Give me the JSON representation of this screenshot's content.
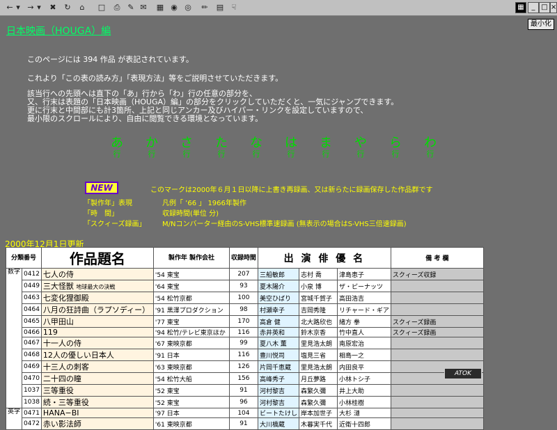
{
  "toolbar": {
    "icons": [
      "back-icon",
      "forward-icon",
      "stop-icon",
      "refresh-icon",
      "home-icon",
      "folder-icon",
      "print-icon",
      "edit-icon",
      "mail-icon",
      "globe-icon",
      "earth-icon",
      "pen-icon",
      "page-icon",
      "hand-icon"
    ],
    "minimize_label": "最小化"
  },
  "page": {
    "title": "日本映画（HOUGA）編",
    "count_line": "このページには 394 作品 が表記されています。",
    "intro_line": "これより「この表の読み方」「表現方法」等をご説明させていただきます。",
    "desc_lines": [
      "該当行への先頭へは直下の「あ」行から「わ」行の任意の部分を、",
      "又、行末は表題の「日本映画（HOUGA）編」の部分をクリックしていただくと、一気にジャンプできます。",
      "更に行末と中間部にも計3箇所、上記と同じアンカー及びハイパー・リンクを設定していますので、",
      "最小限のスクロールにより、自由に閲覧できる環境となっています。"
    ],
    "kana_index": [
      {
        "char": "あ",
        "gyo": "行"
      },
      {
        "char": "か",
        "gyo": "行"
      },
      {
        "char": "さ",
        "gyo": "行"
      },
      {
        "char": "た",
        "gyo": "行"
      },
      {
        "char": "な",
        "gyo": "行"
      },
      {
        "char": "は",
        "gyo": "行"
      },
      {
        "char": "ま",
        "gyo": "行"
      },
      {
        "char": "や",
        "gyo": "行"
      },
      {
        "char": "ら",
        "gyo": "行"
      },
      {
        "char": "わ",
        "gyo": "行"
      }
    ],
    "new_badge": "NEW",
    "new_desc": "このマークは2000年６月１日以降に上書き再録画、又は新らたに録画保存した作品群です",
    "legend": [
      {
        "term": "「製作年」表現",
        "desc": "凡例「 ’66 」 1966年製作"
      },
      {
        "term": "「時　間」",
        "desc": "収録時間(単位 分)"
      },
      {
        "term": "「スクィーズ録画」",
        "desc": "M/Nコンバーター経由のS-VHS標準速録画 (無表示の場合はS-VHS三倍速録画)"
      }
    ],
    "update_date": "2000年12月1日更新"
  },
  "table": {
    "headers": {
      "num": "分類番号",
      "title": "作品題名",
      "year": "製作年 製作会社",
      "minutes": "収録時間",
      "actors": "出 演 俳 優 名",
      "notes": "備 考 欄"
    },
    "categories": [
      {
        "label": "数字",
        "rows": 11
      },
      {
        "label": "英字",
        "rows": 2
      }
    ],
    "rows": [
      {
        "num": "0412",
        "title": "七人の侍",
        "sub": "",
        "year": "'54 東宝",
        "min": "207",
        "a1": "三船敏郎",
        "a2": "志村 喬",
        "a3": "津島恵子",
        "note": "スクィーズ収録"
      },
      {
        "num": "0449",
        "title": "三大怪獣",
        "sub": "地球最大の決戦",
        "year": "'64 東宝",
        "min": "93",
        "a1": "夏木陽介",
        "a2": "小泉 博",
        "a3": "ザ・ピーナッツ",
        "note": ""
      },
      {
        "num": "0463",
        "title": "七変化狸御殿",
        "sub": "",
        "year": "'54 松竹京都",
        "min": "100",
        "a1": "美空ひばり",
        "a2": "宮城千賀子",
        "a3": "高田浩吉",
        "note": ""
      },
      {
        "num": "0464",
        "title": "八月の狂詩曲（ラプソディー）",
        "sub": "",
        "year": "'91 黒澤プロダクション",
        "min": "98",
        "a1": "村瀬幸子",
        "a2": "吉岡秀隆",
        "a3": "リチャード・ギア",
        "note": ""
      },
      {
        "num": "0465",
        "title": "八甲田山",
        "sub": "",
        "year": "'77 東宝",
        "min": "170",
        "a1": "高倉 健",
        "a2": "北大路欣也",
        "a3": "緒方 拳",
        "note": "スクィーズ録画"
      },
      {
        "num": "0466",
        "title": "119",
        "sub": "",
        "year": "'94 松竹/テレビ東京ほか",
        "min": "116",
        "a1": "赤井英和",
        "a2": "鈴木京香",
        "a3": "竹中直人",
        "note": "スクィーズ録画"
      },
      {
        "num": "0467",
        "title": "十一人の侍",
        "sub": "",
        "year": "'67 東映京都",
        "min": "99",
        "a1": "夏八木 薫",
        "a2": "里見浩太朗",
        "a3": "南原宏治",
        "note": ""
      },
      {
        "num": "0468",
        "title": "12人の優しい日本人",
        "sub": "",
        "year": "'91 日本",
        "min": "116",
        "a1": "豊川悦司",
        "a2": "塩見三省",
        "a3": "相島一之",
        "note": ""
      },
      {
        "num": "0469",
        "title": "十三人の刺客",
        "sub": "",
        "year": "'63 東映京都",
        "min": "126",
        "a1": "片岡千恵蔵",
        "a2": "里見浩太朗",
        "a3": "内田良平",
        "note": ""
      },
      {
        "num": "0470",
        "title": "二十四の瞳",
        "sub": "",
        "year": "'54 松竹大船",
        "min": "156",
        "a1": "高峰秀子",
        "a2": "月丘夢路",
        "a3": "小林トシ子",
        "note": ""
      },
      {
        "num": "1037",
        "title": "三等重役",
        "sub": "",
        "year": "'52 東宝",
        "min": "91",
        "a1": "河村黎吉",
        "a2": "森繁久彌",
        "a3": "井上大助",
        "note": ""
      },
      {
        "num": "1038",
        "title": "続・三等重役",
        "sub": "",
        "year": "'52 東宝",
        "min": "96",
        "a1": "河村黎吉",
        "a2": "森繁久彌",
        "a3": "小林桂樹",
        "note": ""
      },
      {
        "num": "0471",
        "title": "HANA−BI",
        "sub": "",
        "year": "'97 日本",
        "min": "104",
        "a1": "ビートたけし",
        "a2": "岸本加世子",
        "a3": "大杉 漣",
        "note": ""
      },
      {
        "num": "0472",
        "title": "赤い影法師",
        "sub": "",
        "year": "'61 東映京都",
        "min": "91",
        "a1": "大川橋蔵",
        "a2": "木暮実千代",
        "a3": "近衛十四郎",
        "note": ""
      }
    ]
  },
  "ime": {
    "label": "ATOK"
  },
  "colors": {
    "bg": "#6f6f6f",
    "title": "#00ff66",
    "kana": "#00dd00",
    "legend": "#ffff00"
  }
}
